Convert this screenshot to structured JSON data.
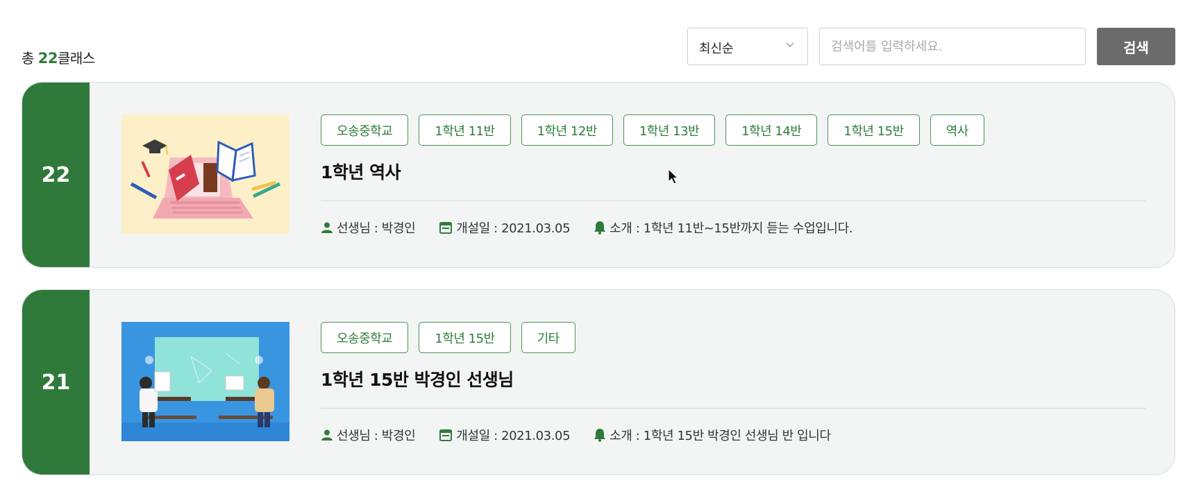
{
  "header": {
    "total_prefix": "총 ",
    "total_count": "22",
    "total_suffix": "클래스",
    "sort_selected": "최신순",
    "search_placeholder": "검색어를 입력하세요.",
    "search_button": "검색"
  },
  "classes": [
    {
      "number": "22",
      "tags": [
        "오송중학교",
        "1학년 11반",
        "1학년 12반",
        "1학년 13반",
        "1학년 14반",
        "1학년 15반",
        "역사"
      ],
      "title": "1학년 역사",
      "teacher": "선생님 : 박경인",
      "opened": "개설일 : 2021.03.05",
      "intro": "소개 : 1학년 11반~15반까지 듣는 수업입니다.",
      "thumbnail_icon": "laptop-books-illustration"
    },
    {
      "number": "21",
      "tags": [
        "오송중학교",
        "1학년 15반",
        "기타"
      ],
      "title": "1학년 15반 박경인 선생님",
      "teacher": "선생님 : 박경인",
      "opened": "개설일 : 2021.03.05",
      "intro": "소개 : 1학년 15반 박경인 선생님 반 입니다",
      "thumbnail_icon": "classroom-students-illustration"
    }
  ],
  "colors": {
    "accent": "#2f7a3b",
    "search_button": "#6b6b6b",
    "card_background": "#f3f5f4"
  }
}
